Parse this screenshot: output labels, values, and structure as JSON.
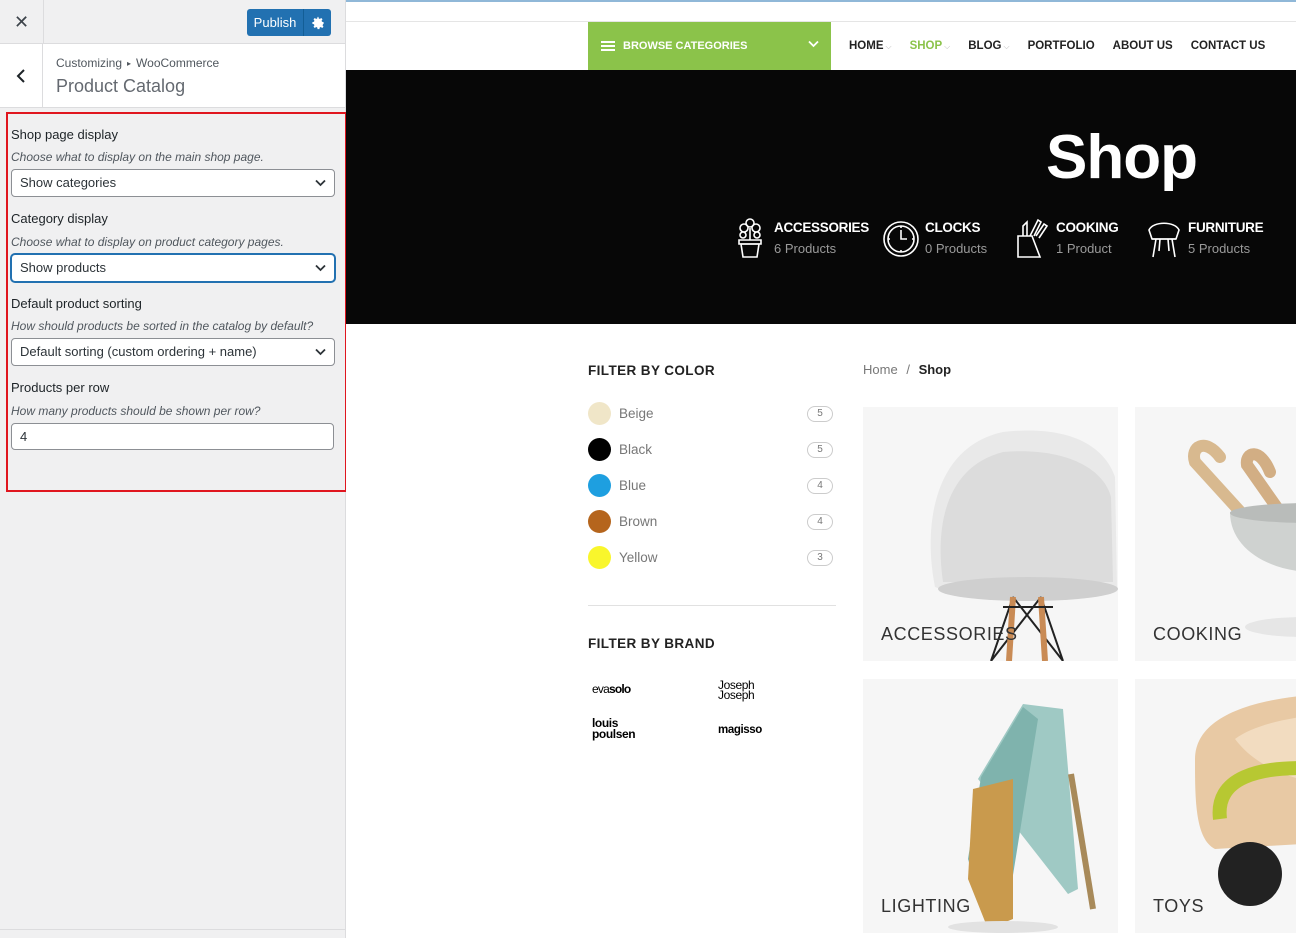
{
  "customizer": {
    "close_label": "✕",
    "publish_label": "Publish",
    "breadcrumb": [
      "Customizing",
      "WooCommerce"
    ],
    "section_title": "Product Catalog",
    "controls": {
      "shop_display": {
        "title": "Shop page display",
        "description": "Choose what to display on the main shop page.",
        "value": "Show categories"
      },
      "category_display": {
        "title": "Category display",
        "description": "Choose what to display on product category pages.",
        "value": "Show products"
      },
      "sorting": {
        "title": "Default product sorting",
        "description": "How should products be sorted in the catalog by default?",
        "value": "Default sorting (custom ordering + name)"
      },
      "per_row": {
        "title": "Products per row",
        "description": "How many products should be shown per row?",
        "value": "4"
      }
    }
  },
  "site": {
    "browse_categories": "BROWSE CATEGORIES",
    "nav": [
      {
        "label": "HOME",
        "caret": true,
        "active": false
      },
      {
        "label": "SHOP",
        "caret": true,
        "active": true
      },
      {
        "label": "BLOG",
        "caret": true,
        "active": false
      },
      {
        "label": "PORTFOLIO",
        "caret": false,
        "active": false
      },
      {
        "label": "ABOUT US",
        "caret": false,
        "active": false
      },
      {
        "label": "CONTACT US",
        "caret": false,
        "active": false
      }
    ],
    "hero": {
      "title": "Shop",
      "categories": [
        {
          "name": "ACCESSORIES",
          "count": "6 Products",
          "icon": "plant-pot-icon"
        },
        {
          "name": "CLOCKS",
          "count": "0 Products",
          "icon": "clock-icon"
        },
        {
          "name": "COOKING",
          "count": "1 Product",
          "icon": "knife-block-icon"
        },
        {
          "name": "FURNITURE",
          "count": "5 Products",
          "icon": "chair-icon"
        }
      ]
    },
    "filter_color": {
      "title": "FILTER BY COLOR",
      "items": [
        {
          "name": "Beige",
          "count": "5",
          "color": "#f0e6c8"
        },
        {
          "name": "Black",
          "count": "5",
          "color": "#000000"
        },
        {
          "name": "Blue",
          "count": "4",
          "color": "#1e9fe0"
        },
        {
          "name": "Brown",
          "count": "4",
          "color": "#b5651d"
        },
        {
          "name": "Yellow",
          "count": "3",
          "color": "#f9f62c"
        }
      ]
    },
    "filter_brand": {
      "title": "FILTER BY BRAND",
      "brands": [
        {
          "line1": "eva",
          "line2": "solo"
        },
        {
          "line1": "Joseph",
          "line2": "Joseph"
        },
        {
          "line1": "louis",
          "line2": "poulsen"
        },
        {
          "line1": "magisso",
          "line2": ""
        }
      ]
    },
    "breadcrumb": {
      "home": "Home",
      "separator": "/",
      "current": "Shop"
    },
    "tiles": [
      "ACCESSORIES",
      "COOKING",
      "LIGHTING",
      "TOYS"
    ],
    "accent_color": "#8bc34a"
  }
}
